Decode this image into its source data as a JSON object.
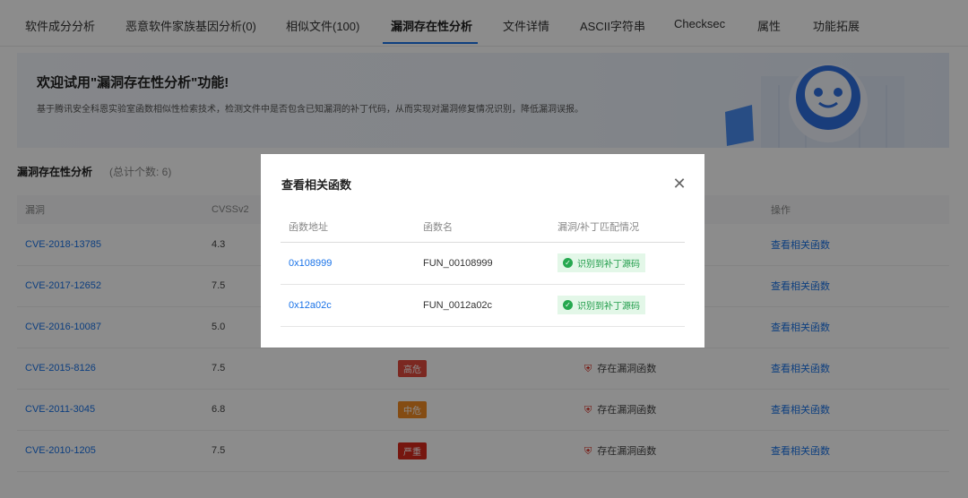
{
  "tabs": [
    {
      "label": "软件成分分析"
    },
    {
      "label": "恶意软件家族基因分析(0)"
    },
    {
      "label": "相似文件(100)"
    },
    {
      "label": "漏洞存在性分析"
    },
    {
      "label": "文件详情"
    },
    {
      "label": "ASCII字符串"
    },
    {
      "label": "Checksec"
    },
    {
      "label": "属性"
    },
    {
      "label": "功能拓展"
    }
  ],
  "active_tab": "漏洞存在性分析",
  "banner": {
    "title": "欢迎试用\"漏洞存在性分析\"功能!",
    "description": "基于腾讯安全科恩实验室函数相似性检索技术，检测文件中是否包含已知漏洞的补丁代码，从而实现对漏洞修复情况识别，降低漏洞误报。"
  },
  "section": {
    "title": "漏洞存在性分析",
    "total": "(总计个数: 6)"
  },
  "table": {
    "headers": {
      "vuln": "漏洞",
      "cvss": "CVSSv2",
      "level": "",
      "status": "",
      "action": "操作"
    },
    "rows": [
      {
        "cve": "CVE-2018-13785",
        "cvss": "4.3",
        "level": "",
        "status": "",
        "action": "查看相关函数"
      },
      {
        "cve": "CVE-2017-12652",
        "cvss": "7.5",
        "level": "",
        "status": "",
        "action": "查看相关函数"
      },
      {
        "cve": "CVE-2016-10087",
        "cvss": "5.0",
        "level": "",
        "status": "",
        "action": "查看相关函数"
      },
      {
        "cve": "CVE-2015-8126",
        "cvss": "7.5",
        "level": "高危",
        "level_color": "#e04a3d",
        "status": "存在漏洞函数",
        "action": "查看相关函数"
      },
      {
        "cve": "CVE-2011-3045",
        "cvss": "6.8",
        "level": "中危",
        "level_color": "#f08a24",
        "status": "存在漏洞函数",
        "action": "查看相关函数"
      },
      {
        "cve": "CVE-2010-1205",
        "cvss": "7.5",
        "level": "严重",
        "level_color": "#d8281c",
        "status": "存在漏洞函数",
        "action": "查看相关函数"
      }
    ]
  },
  "modal": {
    "title": "查看相关函数",
    "close_icon": "close-icon",
    "headers": {
      "address": "函数地址",
      "name": "函数名",
      "match": "漏洞/补丁匹配情况"
    },
    "rows": [
      {
        "address": "0x108999",
        "name": "FUN_00108999",
        "match": "识别到补丁源码"
      },
      {
        "address": "0x12a02c",
        "name": "FUN_0012a02c",
        "match": "识别到补丁源码"
      }
    ]
  },
  "colors": {
    "accent": "#1a73e8",
    "patch_match_bg": "#e3f7e8",
    "patch_match_text": "#1e9b48",
    "overlay": "rgba(0,0,0,0.45)"
  }
}
